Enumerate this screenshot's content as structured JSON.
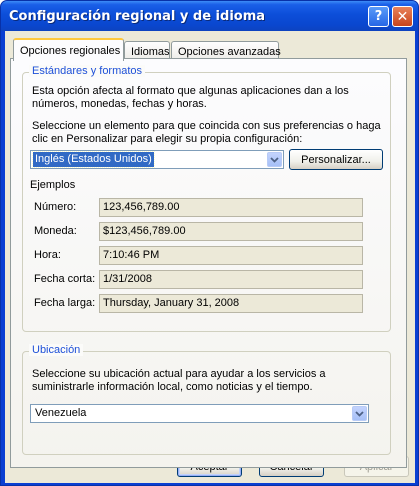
{
  "window": {
    "title": "Configuración regional y de idioma"
  },
  "titlebar": {
    "help_glyph": "?",
    "close_glyph": "✕"
  },
  "tabs": [
    {
      "label": "Opciones regionales",
      "active": true
    },
    {
      "label": "Idiomas",
      "active": false
    },
    {
      "label": "Opciones avanzadas",
      "active": false
    }
  ],
  "standards": {
    "legend": "Estándares y formatos",
    "desc_line1": "Esta opción afecta al formato que algunas aplicaciones dan a los",
    "desc_line2": "números, monedas, fechas y horas.",
    "select_line1": "Seleccione un elemento para que coincida con sus preferencias o haga",
    "select_line2": "clic en Personalizar para elegir su propia configuración:",
    "locale_value": "Inglés (Estados Unidos)",
    "customize_label": "Personalizar...",
    "examples_heading": "Ejemplos",
    "examples": [
      {
        "label": "Número:",
        "value": "123,456,789.00"
      },
      {
        "label": "Moneda:",
        "value": "$123,456,789.00"
      },
      {
        "label": "Hora:",
        "value": "7:10:46 PM"
      },
      {
        "label": "Fecha corta:",
        "value": "1/31/2008"
      },
      {
        "label": "Fecha larga:",
        "value": "Thursday, January 31, 2008"
      }
    ]
  },
  "location": {
    "legend": "Ubicación",
    "desc_line1": "Seleccione su ubicación actual para ayudar a los servicios a",
    "desc_line2": "suministrarle información local, como noticias y el tiempo.",
    "value": "Venezuela"
  },
  "buttons": {
    "ok": "Aceptar",
    "cancel": "Cancelar",
    "apply": "Aplicar"
  }
}
